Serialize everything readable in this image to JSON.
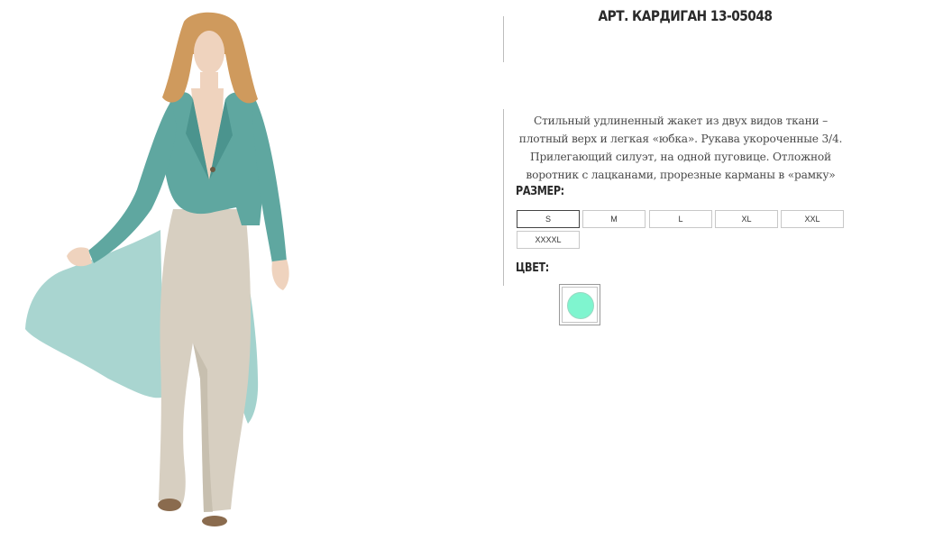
{
  "product": {
    "title": "АРТ. КАРДИГАН 13-05048",
    "description": "Стильный удлиненный жакет из двух видов ткани – плотный верх и легкая «юбка». Рукава укороченные 3/4. Прилегающий силуэт, на одной пуговице. Отложной воротник с лацканами, прорезные карманы в «рамку»",
    "image_alt": "",
    "size_label": "РАЗМЕР:",
    "sizes": [
      "S",
      "M",
      "L",
      "XL",
      "XXL",
      "XXXXL"
    ],
    "selected_size": "S",
    "color_label": "ЦВЕТ:",
    "colors": [
      {
        "value": "#7ff5cf",
        "selected": true
      }
    ]
  },
  "palette": {
    "cardigan": "#5fa7a0",
    "cardigan_shadow": "#48918b",
    "cardigan_sheer": "#8cc7c0",
    "trousers": "#d7cfc1",
    "trousers_shadow": "#bdb4a3",
    "skin": "#efd3be",
    "hair": "#cf9a5d",
    "shoes": "#8a6b4e"
  }
}
